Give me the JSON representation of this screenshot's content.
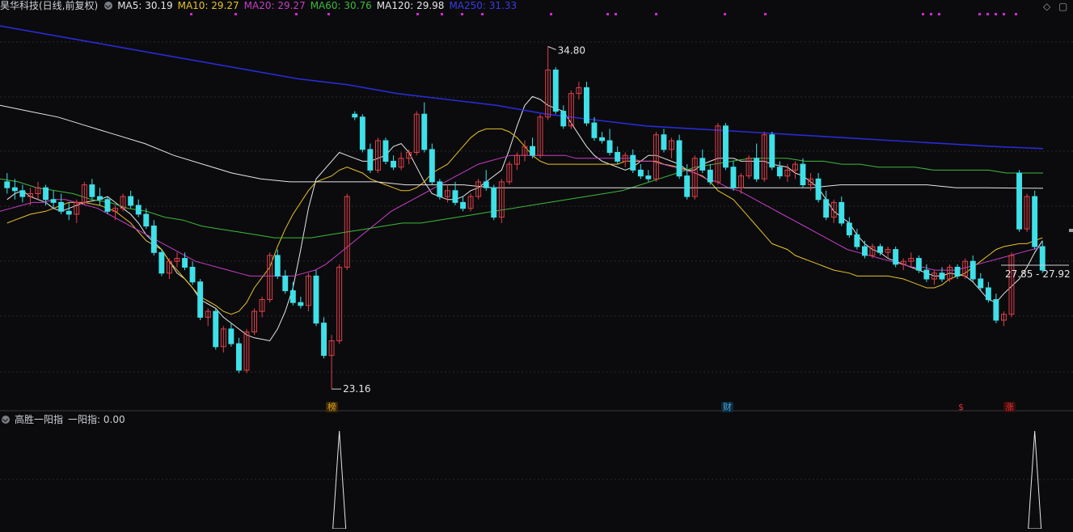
{
  "header": {
    "stock_title": "昊华科技(日线,前复权)",
    "ma_legend": [
      {
        "label": "MA5: 30.19",
        "color": "#e6e6e6"
      },
      {
        "label": "MA10: 29.27",
        "color": "#e6c229"
      },
      {
        "label": "MA20: 29.27",
        "color": "#c73dc7"
      },
      {
        "label": "MA60: 30.76",
        "color": "#3dba3d"
      },
      {
        "label": "MA120: 29.98",
        "color": "#e6e6e6"
      },
      {
        "label": "MA250: 31.33",
        "color": "#2a2ad6"
      }
    ]
  },
  "indicator": {
    "name": "高胜一阳指",
    "value_label": "一阳指: 0.00"
  },
  "annotations": {
    "high_label": "34.80",
    "low_label": "23.16",
    "current_range": "27.85 - 27.92"
  },
  "tags": [
    {
      "text": "榜",
      "color": "#e0a020"
    },
    {
      "text": "财",
      "color": "#4aa3e0"
    },
    {
      "text": "$",
      "color": "#e03030"
    },
    {
      "text": "涨",
      "color": "#e03030"
    }
  ],
  "colors": {
    "up": "#e0404a",
    "down": "#3fe0e8",
    "background": "#0b0b0d",
    "grid": "#2a2a2e",
    "top_marker": "#d22ad2"
  },
  "chart_data": {
    "type": "candlestick",
    "ylim": [
      23.0,
      35.5
    ],
    "candles": [
      [
        30.2,
        30.5,
        29.8,
        30.0
      ],
      [
        30.0,
        30.3,
        29.6,
        29.9
      ],
      [
        29.9,
        30.1,
        29.5,
        29.7
      ],
      [
        29.7,
        30.0,
        29.4,
        29.8
      ],
      [
        29.8,
        30.2,
        29.6,
        30.0
      ],
      [
        30.0,
        30.1,
        29.4,
        29.6
      ],
      [
        29.6,
        29.9,
        29.3,
        29.5
      ],
      [
        29.5,
        29.8,
        29.1,
        29.2
      ],
      [
        29.2,
        29.5,
        28.9,
        29.1
      ],
      [
        29.1,
        29.6,
        28.8,
        29.5
      ],
      [
        29.5,
        30.2,
        29.4,
        30.1
      ],
      [
        30.1,
        30.3,
        29.6,
        29.7
      ],
      [
        29.7,
        30.0,
        29.4,
        29.6
      ],
      [
        29.6,
        29.7,
        29.1,
        29.2
      ],
      [
        29.2,
        29.4,
        28.9,
        29.3
      ],
      [
        29.3,
        29.8,
        29.2,
        29.7
      ],
      [
        29.7,
        29.9,
        29.3,
        29.4
      ],
      [
        29.4,
        29.6,
        29.0,
        29.1
      ],
      [
        29.1,
        29.3,
        28.6,
        28.7
      ],
      [
        28.7,
        28.9,
        27.7,
        27.8
      ],
      [
        27.8,
        27.9,
        27.0,
        27.1
      ],
      [
        27.1,
        27.6,
        26.9,
        27.5
      ],
      [
        27.5,
        27.8,
        27.3,
        27.6
      ],
      [
        27.6,
        27.8,
        27.2,
        27.3
      ],
      [
        27.3,
        27.5,
        26.7,
        26.8
      ],
      [
        26.8,
        26.9,
        25.5,
        25.6
      ],
      [
        25.6,
        25.9,
        25.3,
        25.8
      ],
      [
        25.8,
        25.9,
        24.5,
        24.6
      ],
      [
        24.6,
        25.3,
        24.4,
        25.2
      ],
      [
        25.2,
        25.4,
        24.6,
        24.7
      ],
      [
        24.7,
        24.9,
        23.7,
        23.8
      ],
      [
        23.8,
        25.2,
        23.7,
        25.1
      ],
      [
        25.1,
        25.9,
        25.0,
        25.8
      ],
      [
        25.8,
        26.3,
        25.6,
        26.2
      ],
      [
        26.2,
        27.8,
        26.1,
        27.7
      ],
      [
        27.7,
        27.9,
        26.9,
        27.0
      ],
      [
        27.0,
        27.2,
        26.4,
        26.5
      ],
      [
        26.5,
        26.8,
        26.0,
        26.1
      ],
      [
        26.1,
        26.3,
        25.9,
        26.0
      ],
      [
        26.0,
        27.1,
        25.8,
        27.0
      ],
      [
        27.0,
        27.2,
        25.3,
        25.4
      ],
      [
        25.4,
        25.6,
        24.2,
        24.3
      ],
      [
        24.3,
        25.0,
        23.16,
        24.8
      ],
      [
        24.8,
        27.4,
        24.7,
        27.3
      ],
      [
        27.3,
        29.8,
        27.2,
        29.7
      ],
      [
        32.5,
        32.6,
        32.3,
        32.4
      ],
      [
        32.4,
        32.5,
        31.2,
        31.3
      ],
      [
        31.3,
        31.5,
        30.5,
        30.6
      ],
      [
        30.6,
        31.7,
        30.5,
        31.6
      ],
      [
        31.6,
        31.7,
        30.8,
        30.9
      ],
      [
        30.9,
        31.1,
        30.6,
        30.7
      ],
      [
        30.7,
        31.2,
        30.6,
        31.0
      ],
      [
        31.0,
        31.3,
        30.8,
        31.2
      ],
      [
        31.2,
        32.6,
        31.1,
        32.5
      ],
      [
        32.5,
        32.9,
        31.2,
        31.3
      ],
      [
        31.3,
        31.5,
        30.1,
        30.2
      ],
      [
        30.2,
        30.3,
        29.6,
        29.7
      ],
      [
        29.7,
        30.1,
        29.5,
        29.9
      ],
      [
        29.9,
        30.2,
        29.4,
        29.5
      ],
      [
        29.5,
        29.7,
        29.2,
        29.3
      ],
      [
        29.3,
        29.8,
        29.2,
        29.7
      ],
      [
        29.7,
        30.3,
        29.6,
        30.2
      ],
      [
        30.2,
        30.6,
        29.9,
        30.0
      ],
      [
        30.0,
        30.1,
        28.9,
        29.0
      ],
      [
        29.0,
        30.3,
        28.8,
        30.2
      ],
      [
        30.2,
        30.9,
        30.1,
        30.8
      ],
      [
        30.8,
        31.2,
        30.6,
        31.1
      ],
      [
        31.1,
        31.6,
        30.9,
        31.4
      ],
      [
        31.4,
        31.7,
        31.0,
        31.1
      ],
      [
        31.1,
        32.5,
        31.0,
        32.4
      ],
      [
        32.4,
        34.8,
        32.3,
        34.0
      ],
      [
        34.0,
        34.1,
        32.5,
        32.6
      ],
      [
        32.6,
        32.8,
        32.0,
        32.1
      ],
      [
        32.1,
        33.3,
        32.0,
        33.2
      ],
      [
        33.2,
        33.6,
        33.0,
        33.4
      ],
      [
        33.4,
        33.6,
        32.1,
        32.2
      ],
      [
        32.2,
        32.4,
        31.6,
        31.7
      ],
      [
        31.7,
        31.9,
        31.5,
        31.6
      ],
      [
        31.6,
        32.0,
        31.1,
        31.2
      ],
      [
        31.2,
        31.4,
        30.8,
        30.9
      ],
      [
        30.9,
        31.2,
        30.7,
        31.1
      ],
      [
        31.1,
        31.3,
        30.5,
        30.6
      ],
      [
        30.6,
        30.8,
        30.3,
        30.4
      ],
      [
        30.4,
        30.6,
        30.2,
        30.3
      ],
      [
        30.3,
        31.9,
        30.2,
        31.8
      ],
      [
        31.8,
        32.0,
        31.2,
        31.3
      ],
      [
        31.3,
        31.7,
        31.0,
        31.6
      ],
      [
        31.6,
        31.8,
        30.3,
        30.4
      ],
      [
        30.4,
        30.8,
        29.6,
        29.7
      ],
      [
        29.7,
        31.1,
        29.6,
        31.0
      ],
      [
        31.0,
        31.3,
        30.5,
        30.6
      ],
      [
        30.6,
        30.8,
        30.1,
        30.2
      ],
      [
        30.2,
        32.2,
        30.1,
        32.1
      ],
      [
        32.1,
        32.2,
        30.6,
        30.7
      ],
      [
        30.7,
        30.9,
        29.9,
        30.0
      ],
      [
        30.0,
        30.5,
        29.8,
        30.4
      ],
      [
        30.4,
        31.1,
        30.3,
        31.0
      ],
      [
        31.0,
        31.5,
        30.2,
        30.3
      ],
      [
        30.3,
        31.9,
        30.2,
        31.8
      ],
      [
        31.8,
        31.9,
        30.6,
        30.7
      ],
      [
        30.7,
        30.9,
        30.3,
        30.4
      ],
      [
        30.4,
        30.8,
        30.2,
        30.6
      ],
      [
        30.6,
        30.9,
        30.3,
        30.8
      ],
      [
        30.8,
        31.0,
        30.0,
        30.1
      ],
      [
        30.1,
        30.5,
        29.9,
        30.3
      ],
      [
        30.3,
        30.5,
        29.5,
        29.6
      ],
      [
        29.6,
        29.9,
        28.9,
        29.0
      ],
      [
        29.0,
        29.6,
        28.8,
        29.5
      ],
      [
        29.5,
        29.7,
        28.7,
        28.8
      ],
      [
        28.8,
        29.0,
        28.3,
        28.4
      ],
      [
        28.4,
        28.6,
        27.9,
        28.0
      ],
      [
        28.0,
        28.2,
        27.6,
        27.7
      ],
      [
        27.7,
        28.1,
        27.6,
        28.0
      ],
      [
        28.0,
        28.1,
        27.7,
        27.8
      ],
      [
        27.8,
        28.0,
        27.6,
        27.9
      ],
      [
        27.9,
        28.0,
        27.3,
        27.4
      ],
      [
        27.4,
        27.6,
        27.2,
        27.5
      ],
      [
        27.5,
        27.8,
        27.3,
        27.6
      ],
      [
        27.6,
        27.7,
        27.1,
        27.2
      ],
      [
        27.2,
        27.4,
        26.8,
        26.9
      ],
      [
        26.9,
        27.2,
        26.7,
        27.1
      ],
      [
        27.1,
        27.3,
        26.8,
        26.9
      ],
      [
        26.9,
        27.4,
        26.8,
        27.3
      ],
      [
        27.3,
        27.4,
        26.9,
        27.0
      ],
      [
        27.0,
        27.6,
        26.9,
        27.5
      ],
      [
        27.5,
        27.7,
        26.8,
        26.9
      ],
      [
        26.9,
        27.1,
        26.5,
        26.6
      ],
      [
        26.6,
        26.8,
        26.1,
        26.2
      ],
      [
        26.2,
        26.4,
        25.4,
        25.5
      ],
      [
        25.5,
        25.8,
        25.3,
        25.7
      ],
      [
        25.7,
        27.8,
        25.6,
        27.7
      ],
      [
        30.5,
        30.6,
        28.5,
        28.6
      ],
      [
        28.6,
        29.8,
        28.5,
        29.7
      ],
      [
        29.7,
        29.9,
        27.9,
        28.0
      ],
      [
        28.0,
        28.2,
        27.1,
        27.2
      ]
    ],
    "ma": {
      "MA5": {
        "color": "#e6e6e6",
        "values": [
          29.6,
          29.8,
          29.9,
          29.7,
          29.5,
          29.3,
          29.2,
          29.3,
          29.4,
          29.5,
          29.6,
          29.7,
          29.5,
          29.3,
          29.1,
          28.8,
          28.4,
          27.9,
          27.5,
          27.1,
          26.9,
          26.6,
          26.2,
          25.9,
          25.6,
          25.4,
          25.2,
          25.0,
          24.9,
          24.8,
          25.2,
          25.8,
          26.6,
          27.9,
          29.3,
          30.3,
          30.9,
          31.2,
          31.1,
          31.0,
          30.9,
          30.9,
          31.1,
          31.4,
          31.5,
          31.2,
          30.7,
          30.2,
          29.8,
          29.6,
          29.6,
          29.7,
          29.9,
          30.0,
          30.2,
          30.6,
          31.3,
          32.1,
          32.8,
          33.1,
          33.0,
          32.8,
          32.6,
          32.2,
          31.8,
          31.4,
          31.1,
          30.9,
          30.7,
          30.6,
          30.7,
          30.9,
          31.1,
          31.1,
          31.0,
          30.8,
          30.6,
          30.6,
          30.8,
          30.9,
          31.0,
          31.0,
          30.9,
          30.9,
          30.9,
          30.9,
          30.8,
          30.7,
          30.5,
          30.4,
          30.2,
          30.0,
          29.6,
          29.2,
          28.8,
          28.4,
          28.1,
          27.9,
          27.8,
          27.6,
          27.4,
          27.3,
          27.2,
          27.1,
          27.0,
          27.0,
          27.1,
          27.0,
          26.8,
          26.5,
          26.2,
          26.1,
          26.4,
          26.9,
          27.3,
          27.8,
          28.2
        ]
      },
      "MA10": {
        "color": "#e6c229",
        "values": [
          28.8,
          28.9,
          29.0,
          29.1,
          29.2,
          29.3,
          29.4,
          29.5,
          29.5,
          29.5,
          29.4,
          29.3,
          29.2,
          29.0,
          28.8,
          28.5,
          28.2,
          27.9,
          27.5,
          27.2,
          26.9,
          26.6,
          26.3,
          26.0,
          25.8,
          25.7,
          25.8,
          26.1,
          26.6,
          27.3,
          28.0,
          28.6,
          29.1,
          29.5,
          29.9,
          30.2,
          30.4,
          30.6,
          30.7,
          30.6,
          30.5,
          30.3,
          30.1,
          30.0,
          29.9,
          29.9,
          30.0,
          30.2,
          30.5,
          30.8,
          31.1,
          31.4,
          31.7,
          31.9,
          32.0,
          32.0,
          31.9,
          31.7,
          31.4,
          31.1,
          30.9,
          30.8,
          30.8,
          30.8,
          30.8,
          30.8,
          30.8,
          30.8,
          30.8,
          30.9,
          30.9,
          30.9,
          30.9,
          30.9,
          30.8,
          30.7,
          30.6,
          30.5,
          30.4,
          30.2,
          29.9,
          29.6,
          29.3,
          29.0,
          28.7,
          28.4,
          28.1,
          27.9,
          27.7,
          27.6,
          27.5,
          27.4,
          27.3,
          27.2,
          27.1,
          27.0,
          27.0,
          27.0,
          27.0,
          27.0,
          26.9,
          26.8,
          26.7,
          26.6,
          26.6,
          26.7,
          26.9,
          27.1,
          27.3,
          27.5,
          27.7,
          27.9,
          28.0,
          28.1,
          28.1,
          28.2,
          28.3
        ]
      },
      "MA20": {
        "color": "#c73dc7",
        "values": [
          29.2,
          29.3,
          29.4,
          29.5,
          29.5,
          29.6,
          29.6,
          29.5,
          29.4,
          29.3,
          29.1,
          28.9,
          28.7,
          28.5,
          28.3,
          28.1,
          27.9,
          27.7,
          27.5,
          27.4,
          27.3,
          27.2,
          27.1,
          27.0,
          27.0,
          27.0,
          27.0,
          27.0,
          27.1,
          27.2,
          27.4,
          27.7,
          28.0,
          28.3,
          28.6,
          28.9,
          29.2,
          29.4,
          29.6,
          29.8,
          30.0,
          30.2,
          30.4,
          30.6,
          30.8,
          30.9,
          31.0,
          31.1,
          31.1,
          31.1,
          31.1,
          31.1,
          31.1,
          31.0,
          31.0,
          31.0,
          31.0,
          31.0,
          31.0,
          30.9,
          30.9,
          30.8,
          30.7,
          30.6,
          30.5,
          30.3,
          30.2,
          30.0,
          29.9,
          29.7,
          29.5,
          29.3,
          29.1,
          28.9,
          28.7,
          28.5,
          28.3,
          28.1,
          27.9,
          27.8,
          27.7,
          27.6,
          27.5,
          27.4,
          27.3,
          27.3,
          27.2,
          27.2,
          27.2,
          27.3,
          27.4,
          27.5,
          27.6,
          27.7,
          27.8,
          27.9,
          28.0
        ]
      },
      "MA60": {
        "color": "#3dba3d",
        "values": [
          30.3,
          30.2,
          30.0,
          29.9,
          29.8,
          29.6,
          29.5,
          29.3,
          29.2,
          29.0,
          28.9,
          28.7,
          28.6,
          28.5,
          28.4,
          28.3,
          28.3,
          28.3,
          28.4,
          28.5,
          28.6,
          28.7,
          28.8,
          28.8,
          28.9,
          29.0,
          29.1,
          29.2,
          29.3,
          29.4,
          29.5,
          29.6,
          29.7,
          29.8,
          29.9,
          30.1,
          30.3,
          30.5,
          30.7,
          30.8,
          30.9,
          31.0,
          31.0,
          31.0,
          30.9,
          30.9,
          30.8,
          30.8,
          30.7,
          30.7,
          30.7,
          30.6,
          30.6,
          30.6,
          30.6,
          30.5,
          30.5,
          30.5
        ]
      },
      "MA120": {
        "color": "#e6e6e6",
        "values": [
          32.8,
          32.6,
          32.4,
          32.1,
          31.8,
          31.5,
          31.1,
          30.8,
          30.5,
          30.3,
          30.2,
          30.2,
          30.2,
          30.2,
          30.1,
          30.1,
          30.1,
          30.0,
          30.0,
          30.0,
          30.0,
          30.0,
          30.0,
          30.0,
          30.0,
          30.0,
          30.0,
          30.0,
          30.0,
          30.1,
          30.1,
          30.1,
          30.1,
          30.0,
          30.0,
          29.99,
          29.98
        ]
      },
      "MA250": {
        "color": "#2a2ad6",
        "values": [
          35.5,
          35.2,
          34.9,
          34.6,
          34.3,
          34.0,
          33.7,
          33.5,
          33.2,
          33.0,
          32.8,
          32.5,
          32.3,
          32.1,
          32.0,
          31.9,
          31.8,
          31.7,
          31.6,
          31.5,
          31.4,
          31.33
        ]
      }
    },
    "indicator_spikes_at": [
      43,
      133
    ]
  }
}
